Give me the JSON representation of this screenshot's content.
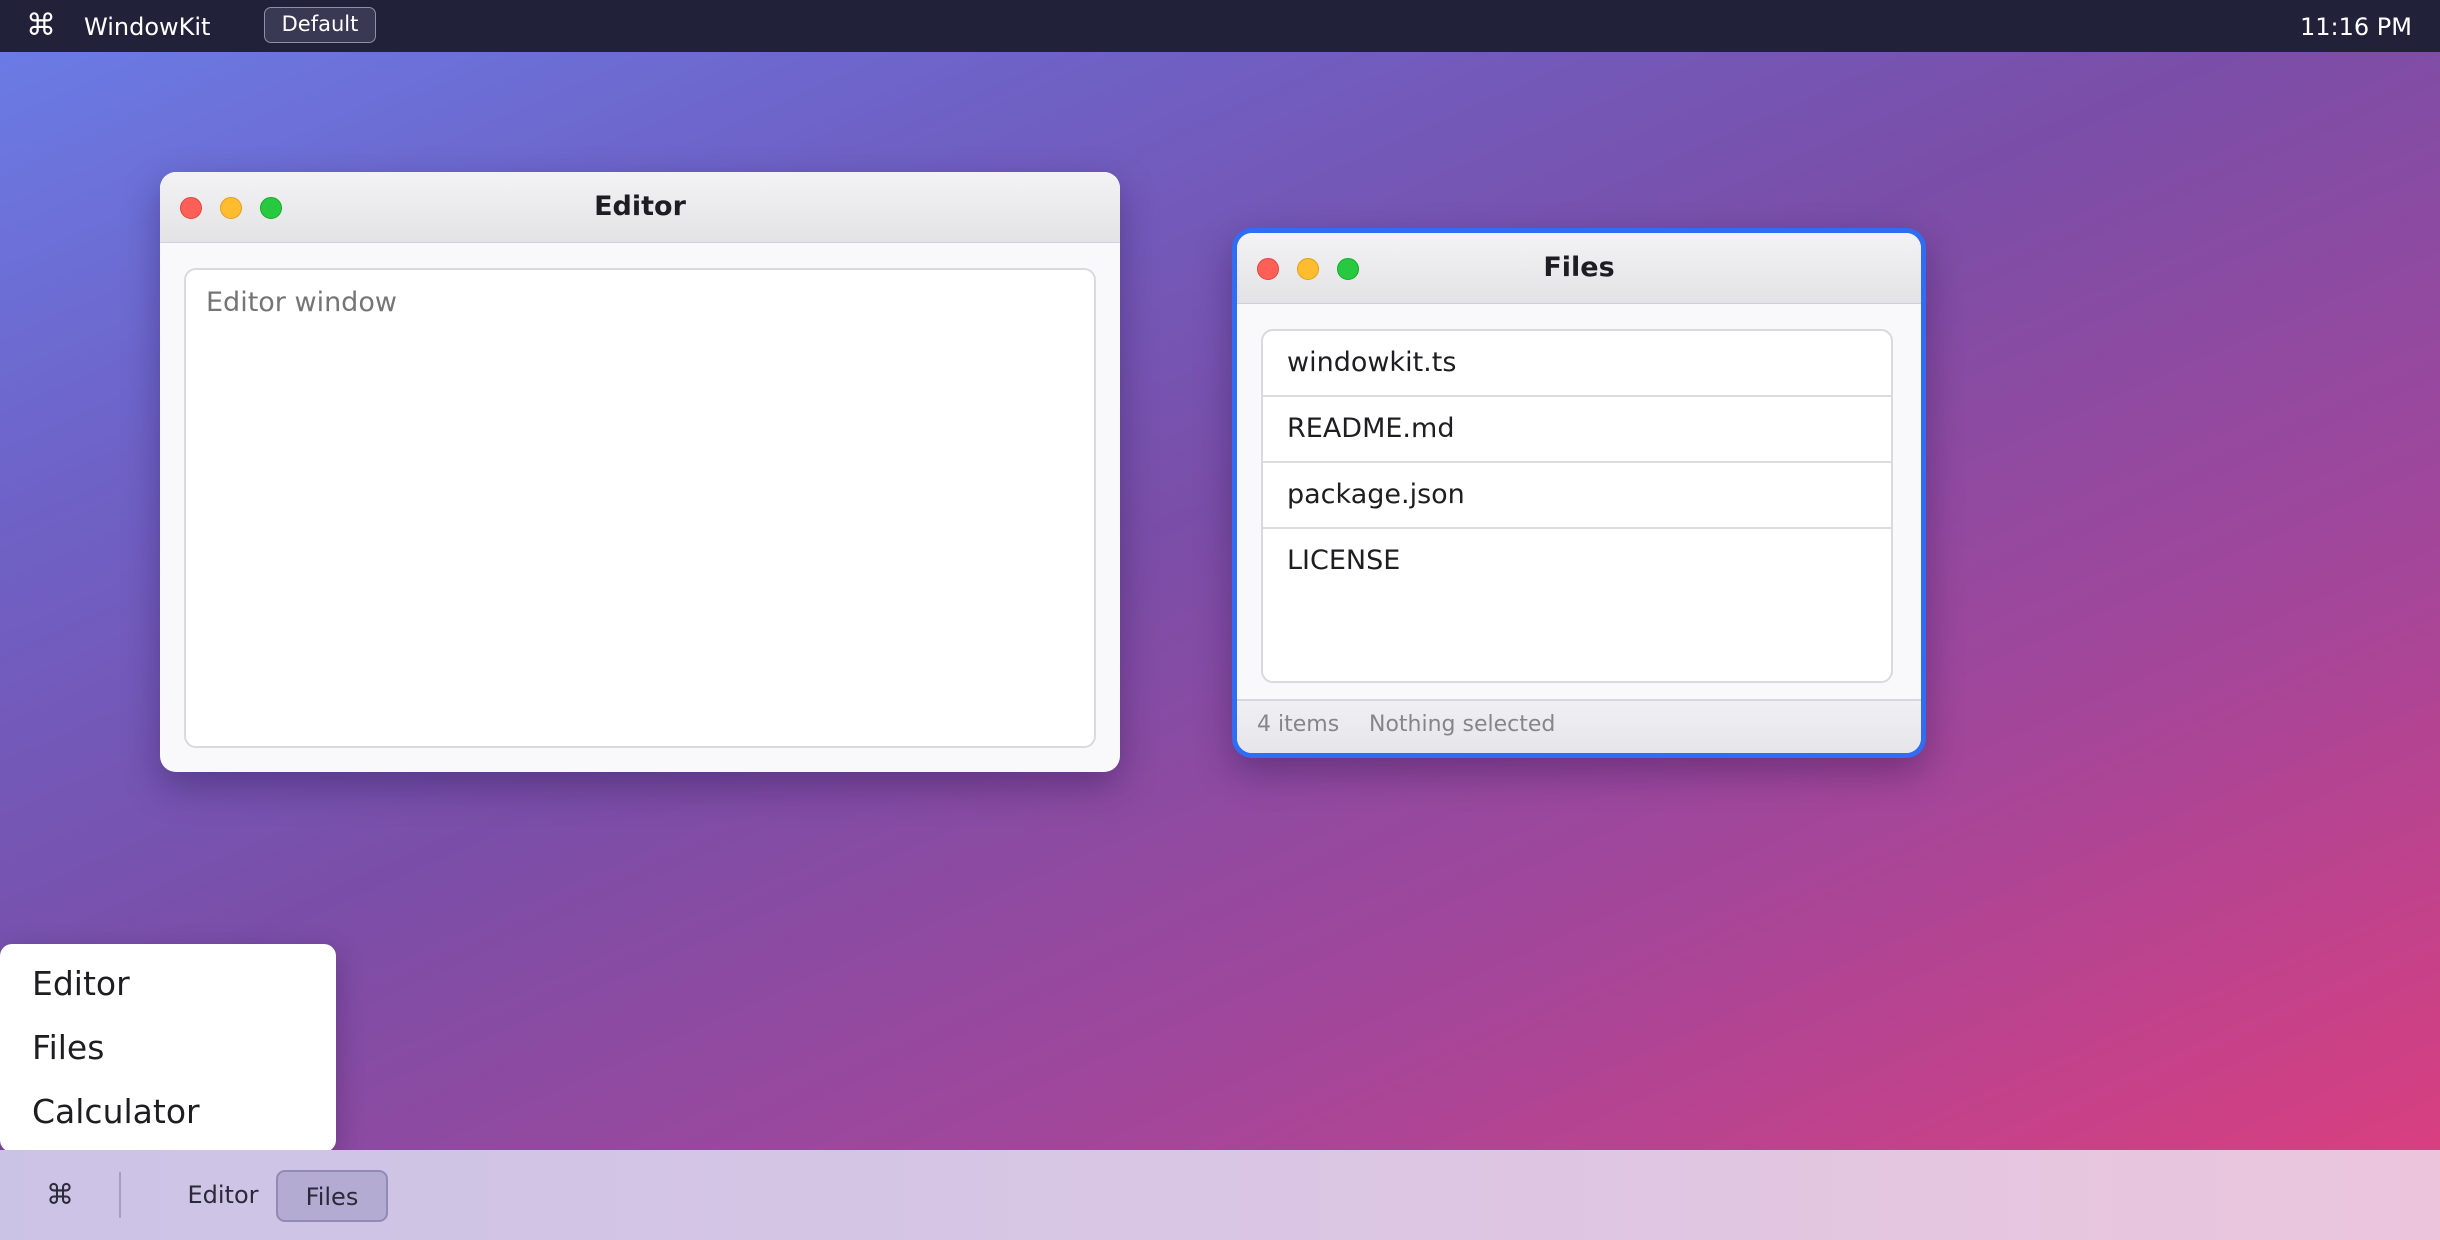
{
  "menubar": {
    "logo_icon": "⌘",
    "app_name": "WindowKit",
    "theme_button": "Default",
    "clock": "11:16 PM"
  },
  "editor_window": {
    "title": "Editor",
    "placeholder": "Editor window",
    "value": ""
  },
  "files_window": {
    "title": "Files",
    "focused": true,
    "files": [
      "windowkit.ts",
      "README.md",
      "package.json",
      "LICENSE"
    ],
    "status": {
      "count": "4 items",
      "selection": "Nothing selected"
    }
  },
  "launcher_menu": {
    "items": [
      "Editor",
      "Files",
      "Calculator"
    ]
  },
  "taskbar": {
    "start_icon": "⌘",
    "tasks": [
      {
        "label": "Editor",
        "active": false
      },
      {
        "label": "Files",
        "active": true
      }
    ]
  },
  "colors": {
    "accent": "#2f6df5",
    "close": "#fe5f57",
    "minimize": "#febc2e",
    "maximize": "#28c840"
  }
}
